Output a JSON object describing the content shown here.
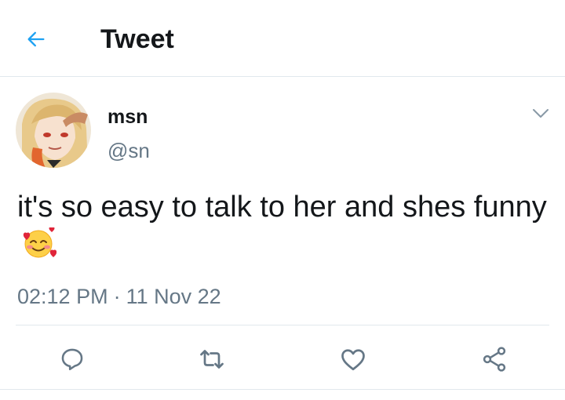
{
  "header": {
    "title": "Tweet",
    "back_icon": "arrow-left-icon"
  },
  "tweet": {
    "display_name": "msn",
    "handle": "@sn",
    "text": "it's so easy to talk to her and shes funny",
    "emoji": "smiling-face-with-hearts",
    "time": "02:12 PM",
    "separator": "·",
    "date": "11 Nov 22"
  },
  "actions": [
    "reply-icon",
    "retweet-icon",
    "like-icon",
    "share-icon"
  ],
  "colors": {
    "accent": "#1da1f2",
    "secondary_text": "#657786",
    "divider": "#e1e8ed",
    "icon": "#657786"
  }
}
